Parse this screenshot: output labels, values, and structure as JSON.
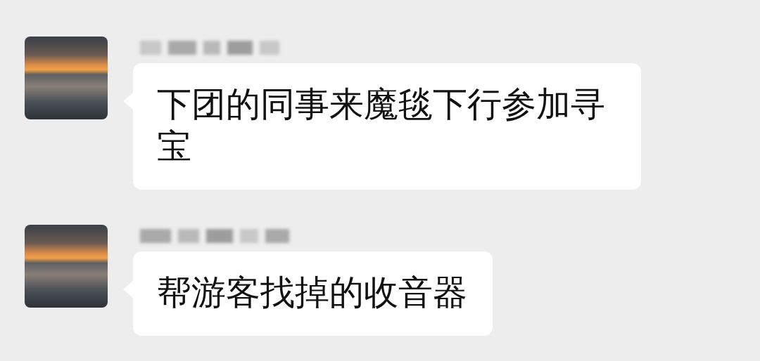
{
  "chat": {
    "messages": [
      {
        "text": "下团的同事来魔毯下行参加寻宝"
      },
      {
        "text": "帮游客找掉的收音器"
      }
    ]
  }
}
